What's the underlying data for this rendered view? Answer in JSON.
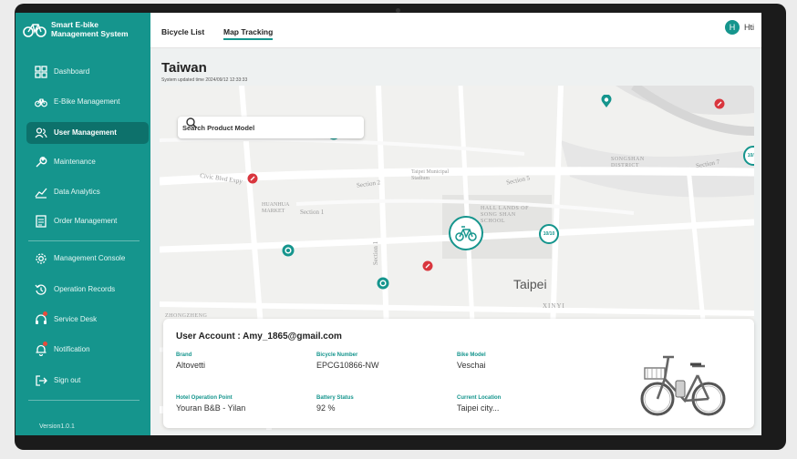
{
  "brand": {
    "line1": "Smart E-bike",
    "line2": "Management System"
  },
  "sidebar": {
    "items": [
      {
        "label": "Dashboard",
        "icon": "grid-icon"
      },
      {
        "label": "E-Bike Management",
        "icon": "bicycle-icon"
      },
      {
        "label": "User Management",
        "icon": "users-icon",
        "active": true
      },
      {
        "label": "Maintenance",
        "icon": "wrench-icon"
      },
      {
        "label": "Data Analytics",
        "icon": "chart-icon"
      },
      {
        "label": "Order Management",
        "icon": "document-icon"
      },
      {
        "label": "Management Console",
        "icon": "gear-icon"
      },
      {
        "label": "Operation Records",
        "icon": "records-icon"
      },
      {
        "label": "Service Desk",
        "icon": "headset-icon"
      },
      {
        "label": "Notification",
        "icon": "bell-icon"
      },
      {
        "label": "Sign out",
        "icon": "signout-icon"
      }
    ],
    "version": "Version1.0.1"
  },
  "topbar": {
    "tabs": [
      "Bicycle List",
      "Map Tracking"
    ],
    "active_tab": "Map Tracking",
    "user_initial": "H",
    "user_name": "Hti"
  },
  "page": {
    "title": "Taiwan",
    "subtitle": "System updated time 2024/09/12 12:33:33"
  },
  "search": {
    "placeholder": "Search Product Model"
  },
  "map": {
    "city_label": "Taipei",
    "labels": [
      "Civic Blvd Expy",
      "Section 1",
      "HUANHUA MARKET",
      "Section 2",
      "Taipei Municipal Stadium",
      "Section 5",
      "SONGSHAN DISTRICT",
      "Section 7",
      "XINYI",
      "ZHONGZHENG",
      "Section 1",
      "HALL LANDS OF SONG SHAN SCHOOL"
    ],
    "cluster_label": "10/10"
  },
  "info": {
    "account_label": "User Account : Amy_1865@gmail.com",
    "fields": [
      {
        "label": "Brand",
        "value": "Altovetti"
      },
      {
        "label": "Bicycle Number",
        "value": "EPCG10866-NW"
      },
      {
        "label": "Bike Model",
        "value": "Veschai"
      },
      {
        "label": "Hotel Operation Point",
        "value": "Youran B&B - Yilan"
      },
      {
        "label": "Battery Status",
        "value": "92 %"
      },
      {
        "label": "Current Location",
        "value": "Taipei city..."
      }
    ]
  },
  "colors": {
    "primary": "#15958d",
    "active": "#0d716b",
    "alert": "#d9363e"
  }
}
